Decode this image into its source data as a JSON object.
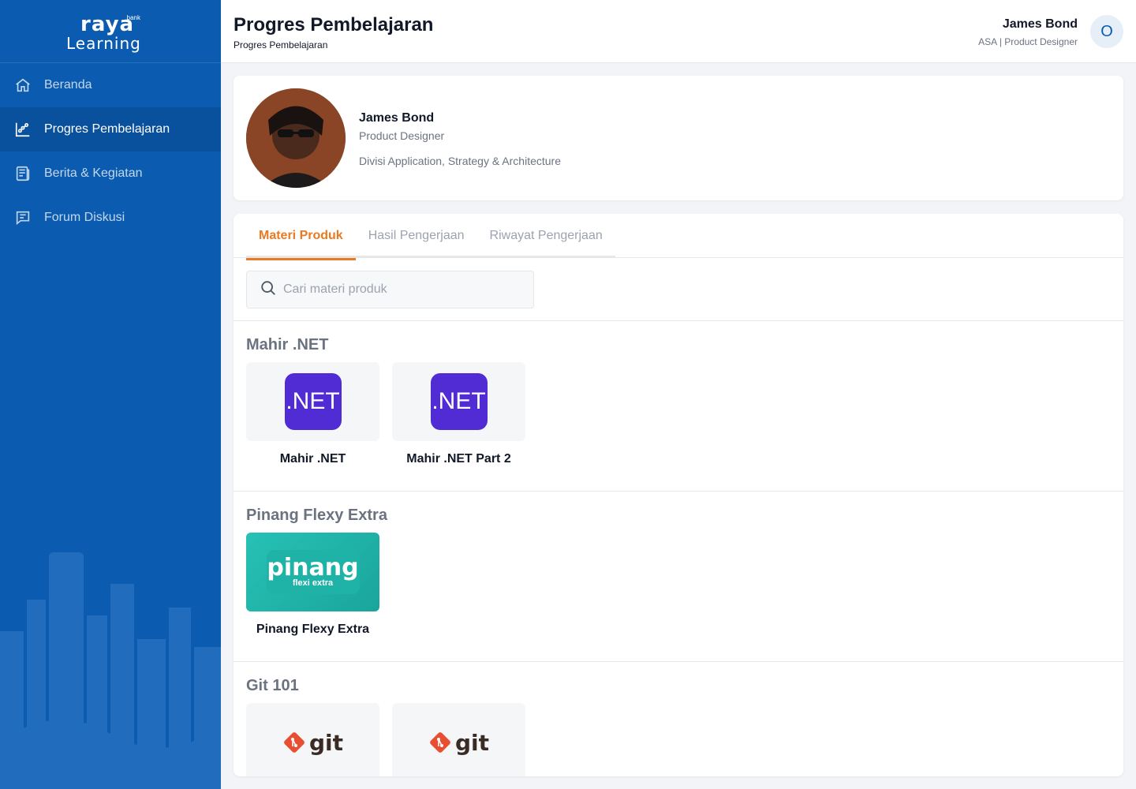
{
  "sidebar": {
    "logo": {
      "bank": "bank",
      "raya": "raya",
      "learning": "Learning"
    },
    "items": [
      {
        "label": "Beranda",
        "icon": "home-icon",
        "active": false
      },
      {
        "label": "Progres Pembelajaran",
        "icon": "progress-chart-icon",
        "active": true
      },
      {
        "label": "Berita & Kegiatan",
        "icon": "news-icon",
        "active": false
      },
      {
        "label": "Forum Diskusi",
        "icon": "chat-icon",
        "active": false
      }
    ]
  },
  "header": {
    "title": "Progres Pembelajaran",
    "breadcrumb": "Progres Pembelajaran",
    "user_name": "James Bond",
    "user_role": "ASA | Product Designer",
    "avatar_initial": "O"
  },
  "profile": {
    "name": "James Bond",
    "role": "Product Designer",
    "division": "Divisi Application, Strategy & Architecture"
  },
  "tabs": [
    {
      "label": "Materi Produk",
      "active": true
    },
    {
      "label": "Hasil Pengerjaan",
      "active": false
    },
    {
      "label": "Riwayat Pengerjaan",
      "active": false
    }
  ],
  "search": {
    "placeholder": "Cari materi produk",
    "value": ""
  },
  "sections": [
    {
      "title": "Mahir .NET",
      "items": [
        {
          "label": "Mahir .NET",
          "logo_text": ".NET"
        },
        {
          "label": "Mahir .NET  Part 2",
          "logo_text": ".NET"
        }
      ]
    },
    {
      "title": "Pinang Flexy Extra",
      "items": [
        {
          "label": "Pinang Flexy Extra",
          "logo_text": "pinang",
          "logo_sub": "flexi extra"
        }
      ]
    },
    {
      "title": "Git 101",
      "items": [
        {
          "logo_text": "git"
        },
        {
          "logo_text": "git"
        }
      ]
    }
  ],
  "colors": {
    "sidebar": "#0b5cb0",
    "accent": "#ea7a22",
    "net_purple": "#512bd4",
    "pinang_teal": "#1fb3a8",
    "git_orange": "#e84e31"
  }
}
